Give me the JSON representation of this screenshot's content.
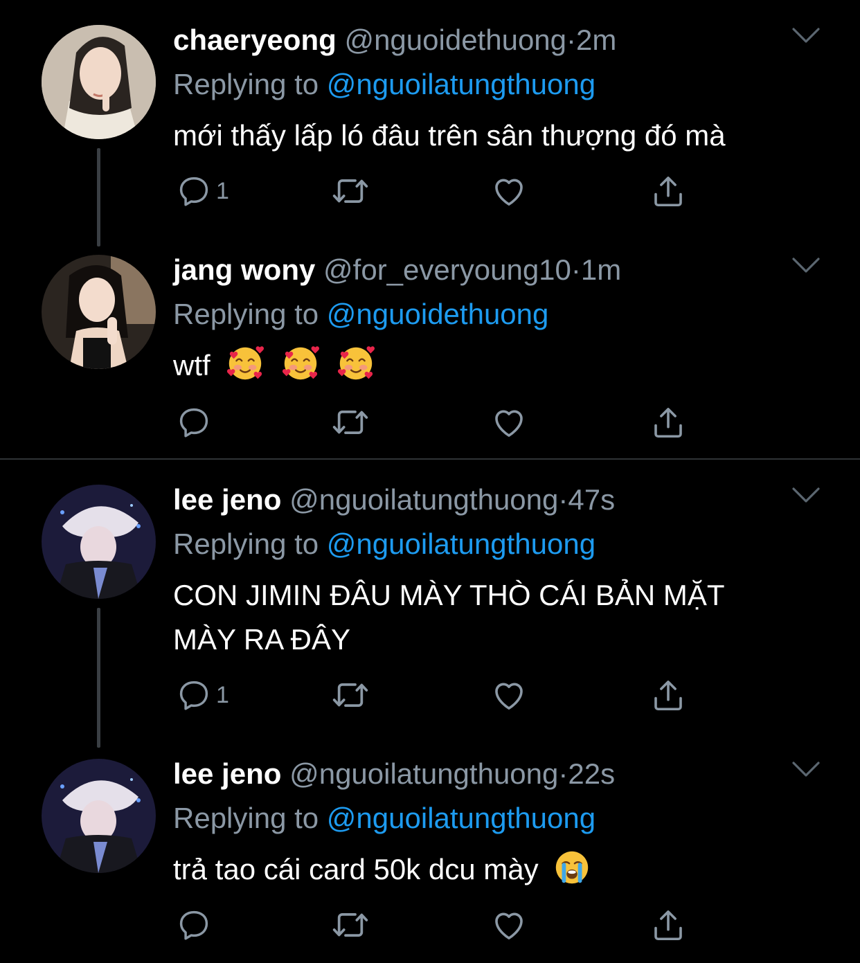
{
  "colors": {
    "background": "#000000",
    "primary_text": "#ffffff",
    "secondary_text": "#8b98a5",
    "accent": "#1d9bf0",
    "divider": "#2f3336"
  },
  "tweets": [
    {
      "name": "chaeryeong",
      "handle": "@nguoidethuong",
      "separator": "·",
      "time": "2m",
      "replying_prefix": "Replying to",
      "replying_to": "@nguoilatungthuong",
      "text": "mới thấy lấp ló đâu trên sân thượng đó mà",
      "reply_count": "1",
      "icons": [
        "reply-icon",
        "retweet-icon",
        "like-icon",
        "share-icon",
        "chevron-down-icon"
      ]
    },
    {
      "name": "jang wony",
      "handle": "@for_everyoung10",
      "separator": "·",
      "time": "1m",
      "replying_prefix": "Replying to",
      "replying_to": "@nguoidethuong",
      "text": "wtf",
      "emojis": [
        "smiling-face-with-hearts",
        "smiling-face-with-hearts",
        "smiling-face-with-hearts"
      ],
      "reply_count": "",
      "icons": [
        "reply-icon",
        "retweet-icon",
        "like-icon",
        "share-icon",
        "chevron-down-icon"
      ]
    },
    {
      "name": "lee jeno",
      "handle": "@nguoilatungthuong",
      "separator": "·",
      "time": "47s",
      "replying_prefix": "Replying to",
      "replying_to": "@nguoilatungthuong",
      "text_line1": "CON JIMIN ĐÂU MÀY THÒ CÁI BẢN MẶT",
      "text_line2": "MÀY RA ĐÂY",
      "reply_count": "1",
      "icons": [
        "reply-icon",
        "retweet-icon",
        "like-icon",
        "share-icon",
        "chevron-down-icon"
      ]
    },
    {
      "name": "lee jeno",
      "handle": "@nguoilatungthuong",
      "separator": "·",
      "time": "22s",
      "replying_prefix": "Replying to",
      "replying_to": "@nguoilatungthuong",
      "text": "trả tao cái card 50k dcu mày",
      "emojis": [
        "loudly-crying-face"
      ],
      "reply_count": "",
      "icons": [
        "reply-icon",
        "retweet-icon",
        "like-icon",
        "share-icon",
        "chevron-down-icon"
      ]
    }
  ]
}
